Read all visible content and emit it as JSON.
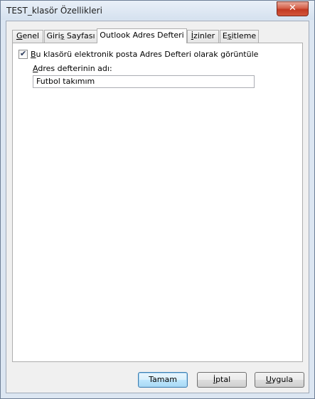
{
  "window": {
    "title": "TEST_klasör Özellikleri",
    "close_glyph": "✕"
  },
  "tabs": [
    {
      "label_prefix": "",
      "mnemonic": "G",
      "label_rest": "enel",
      "active": false
    },
    {
      "label_prefix": "Giri",
      "mnemonic": "ş",
      "label_rest": " Sayfası",
      "active": false
    },
    {
      "label_prefix": "Outlook Adres Defteri",
      "mnemonic": "",
      "label_rest": "",
      "active": true
    },
    {
      "label_prefix": "",
      "mnemonic": "İ",
      "label_rest": "zinler",
      "active": false
    },
    {
      "label_prefix": "E",
      "mnemonic": "ş",
      "label_rest": "itleme",
      "active": false
    }
  ],
  "address_book": {
    "checkbox_checked": true,
    "checkbox_label_mnemonic": "B",
    "checkbox_label_rest": "u klasörü elektronik posta Adres Defteri olarak görüntüle",
    "name_label_mnemonic": "A",
    "name_label_rest": "dres defterinin adı:",
    "name_value": "Futbol takımım"
  },
  "buttons": {
    "ok": "Tamam",
    "cancel_mnemonic": "İ",
    "cancel_rest": "ptal",
    "apply_mnemonic": "U",
    "apply_rest": "ygula"
  }
}
